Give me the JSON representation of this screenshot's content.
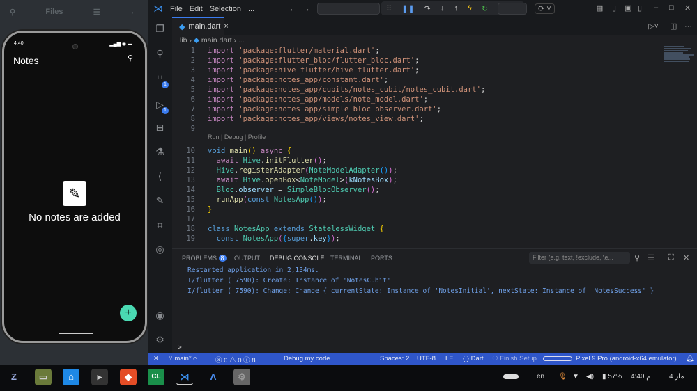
{
  "left_panel": {
    "title": "Files"
  },
  "phone": {
    "time": "4:40",
    "app_title": "Notes",
    "empty_text": "No notes are added",
    "fab": "+"
  },
  "titlebar": {
    "menus": [
      "File",
      "Edit",
      "Selection",
      "..."
    ]
  },
  "tab": {
    "label": "main.dart",
    "close": "×"
  },
  "breadcrumb": {
    "folder": "lib",
    "file": "main.dart",
    "more": "..."
  },
  "editor": {
    "codelens": "Run | Debug | Profile",
    "lines": [
      {
        "n": "1",
        "tokens": [
          [
            "import ",
            "kc"
          ],
          [
            "'package:flutter/material.dart'",
            "s"
          ],
          [
            ";",
            "p"
          ]
        ]
      },
      {
        "n": "2",
        "tokens": [
          [
            "import ",
            "kc"
          ],
          [
            "'package:flutter_bloc/flutter_bloc.dart'",
            "s"
          ],
          [
            ";",
            "p"
          ]
        ]
      },
      {
        "n": "3",
        "tokens": [
          [
            "import ",
            "kc"
          ],
          [
            "'package:hive_flutter/hive_flutter.dart'",
            "s"
          ],
          [
            ";",
            "p"
          ]
        ]
      },
      {
        "n": "4",
        "tokens": [
          [
            "import ",
            "kc"
          ],
          [
            "'package:notes_app/constant.dart'",
            "s"
          ],
          [
            ";",
            "p"
          ]
        ]
      },
      {
        "n": "5",
        "tokens": [
          [
            "import ",
            "kc"
          ],
          [
            "'package:notes_app/cubits/notes_cubit/notes_cubit.dart'",
            "s"
          ],
          [
            ";",
            "p"
          ]
        ]
      },
      {
        "n": "6",
        "tokens": [
          [
            "import ",
            "kc"
          ],
          [
            "'package:notes_app/models/note_model.dart'",
            "s"
          ],
          [
            ";",
            "p"
          ]
        ]
      },
      {
        "n": "7",
        "tokens": [
          [
            "import ",
            "kc"
          ],
          [
            "'package:notes_app/simple_bloc_observer.dart'",
            "s"
          ],
          [
            ";",
            "p"
          ]
        ]
      },
      {
        "n": "8",
        "tokens": [
          [
            "import ",
            "kc"
          ],
          [
            "'package:notes_app/views/notes_view.dart'",
            "s"
          ],
          [
            ";",
            "p"
          ]
        ]
      },
      {
        "n": "9",
        "tokens": []
      },
      {
        "n": "10",
        "tokens": [
          [
            "void ",
            "k"
          ],
          [
            "main",
            "f"
          ],
          [
            "() ",
            "b1"
          ],
          [
            "async ",
            "kc"
          ],
          [
            "{",
            "b1"
          ]
        ]
      },
      {
        "n": "11",
        "tokens": [
          [
            "  await ",
            "kc"
          ],
          [
            "Hive",
            "t"
          ],
          [
            ".",
            "p"
          ],
          [
            "initFlutter",
            "f"
          ],
          [
            "()",
            "b2"
          ],
          [
            ";",
            "p"
          ]
        ]
      },
      {
        "n": "12",
        "tokens": [
          [
            "  Hive",
            "t"
          ],
          [
            ".",
            "p"
          ],
          [
            "registerAdapter",
            "f"
          ],
          [
            "(",
            "b2"
          ],
          [
            "NoteModelAdapter",
            "t"
          ],
          [
            "()",
            "b3"
          ],
          [
            ")",
            "b2"
          ],
          [
            ";",
            "p"
          ]
        ]
      },
      {
        "n": "13",
        "tokens": [
          [
            "  await ",
            "kc"
          ],
          [
            "Hive",
            "t"
          ],
          [
            ".",
            "p"
          ],
          [
            "openBox",
            "f"
          ],
          [
            "<",
            "p"
          ],
          [
            "NoteModel",
            "t"
          ],
          [
            ">",
            "p"
          ],
          [
            "(",
            "b2"
          ],
          [
            "kNotesBox",
            "v"
          ],
          [
            ")",
            "b2"
          ],
          [
            ";",
            "p"
          ]
        ]
      },
      {
        "n": "14",
        "tokens": [
          [
            "  Bloc",
            "t"
          ],
          [
            ".",
            "p"
          ],
          [
            "observer",
            "v"
          ],
          [
            " = ",
            "p"
          ],
          [
            "SimpleBlocObserver",
            "t"
          ],
          [
            "()",
            "b2"
          ],
          [
            ";",
            "p"
          ]
        ]
      },
      {
        "n": "15",
        "tokens": [
          [
            "  runApp",
            "f"
          ],
          [
            "(",
            "b2"
          ],
          [
            "const ",
            "k"
          ],
          [
            "NotesApp",
            "t"
          ],
          [
            "()",
            "b3"
          ],
          [
            ")",
            "b2"
          ],
          [
            ";",
            "p"
          ]
        ]
      },
      {
        "n": "16",
        "tokens": [
          [
            "}",
            "b1"
          ]
        ]
      },
      {
        "n": "17",
        "tokens": []
      },
      {
        "n": "18",
        "tokens": [
          [
            "class ",
            "k"
          ],
          [
            "NotesApp ",
            "t"
          ],
          [
            "extends ",
            "k"
          ],
          [
            "StatelessWidget ",
            "t"
          ],
          [
            "{",
            "b1"
          ]
        ]
      },
      {
        "n": "19",
        "tokens": [
          [
            "  const ",
            "k"
          ],
          [
            "NotesApp",
            "t"
          ],
          [
            "(",
            "b2"
          ],
          [
            "{",
            "b3"
          ],
          [
            "super",
            "k"
          ],
          [
            ".",
            "p"
          ],
          [
            "key",
            "v"
          ],
          [
            "}",
            "b3"
          ],
          [
            ")",
            "b2"
          ],
          [
            ";",
            "p"
          ]
        ]
      }
    ]
  },
  "panel": {
    "tabs": [
      "PROBLEMS",
      "OUTPUT",
      "DEBUG CONSOLE",
      "TERMINAL",
      "PORTS"
    ],
    "problems_count": "8",
    "filter_placeholder": "Filter (e.g. text, !exclude, \\e...",
    "console": [
      "Restarted application in 2,134ms.",
      "I/flutter ( 7590): Create: Instance of 'NotesCubit'",
      "I/flutter ( 7590): Change: Change { currentState: Instance of 'NotesInitial', nextState: Instance of 'NotesSuccess' }"
    ],
    "prompt": ">"
  },
  "activity": {
    "scm_badge": "1",
    "debug_badge": "1"
  },
  "statusbar": {
    "branch": "main*",
    "errors": "0",
    "warnings": "0",
    "infos": "8",
    "debug": "Debug my code",
    "spaces": "Spaces: 2",
    "encoding": "UTF-8",
    "eol": "LF",
    "language": "Dart",
    "finish_setup": "Finish Setup",
    "device": "Pixel 9 Pro (android-x64 emulator)"
  },
  "taskbar": {
    "lang": "en",
    "battery": "57%",
    "time": "4:40 م",
    "date": "4 مار"
  }
}
